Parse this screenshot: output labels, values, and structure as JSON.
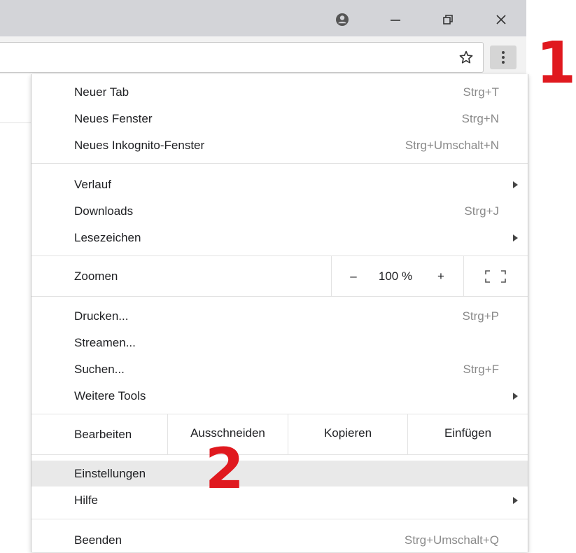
{
  "window": {
    "profile_icon": "account-circle-icon",
    "minimize_icon": "minimize-icon",
    "restore_icon": "restore-icon",
    "close_icon": "close-icon"
  },
  "toolbar": {
    "bookmark_icon": "star-outline-icon",
    "menu_icon": "vertical-dots-icon"
  },
  "annotations": {
    "step1": "1",
    "step2": "2"
  },
  "menu": {
    "section1": [
      {
        "label": "Neuer Tab",
        "shortcut": "Strg+T"
      },
      {
        "label": "Neues Fenster",
        "shortcut": "Strg+N"
      },
      {
        "label": "Neues Inkognito-Fenster",
        "shortcut": "Strg+Umschalt+N"
      }
    ],
    "section2": [
      {
        "label": "Verlauf",
        "shortcut": ""
      },
      {
        "label": "Downloads",
        "shortcut": "Strg+J"
      },
      {
        "label": "Lesezeichen",
        "shortcut": ""
      }
    ],
    "zoom": {
      "label": "Zoomen",
      "minus": "–",
      "value": "100 %",
      "plus": "+",
      "fullscreen_icon": "fullscreen-icon"
    },
    "section4": [
      {
        "label": "Drucken...",
        "shortcut": "Strg+P"
      },
      {
        "label": "Streamen...",
        "shortcut": ""
      },
      {
        "label": "Suchen...",
        "shortcut": "Strg+F"
      },
      {
        "label": "Weitere Tools",
        "shortcut": ""
      }
    ],
    "edit": {
      "label": "Bearbeiten",
      "cut": "Ausschneiden",
      "copy": "Kopieren",
      "paste": "Einfügen"
    },
    "section6": [
      {
        "label": "Einstellungen",
        "shortcut": ""
      },
      {
        "label": "Hilfe",
        "shortcut": ""
      }
    ],
    "section7": [
      {
        "label": "Beenden",
        "shortcut": "Strg+Umschalt+Q"
      }
    ]
  },
  "colors": {
    "annotation_red": "#e0191f",
    "titlebar": "#d3d4d8",
    "highlight": "#e9e9e9"
  }
}
